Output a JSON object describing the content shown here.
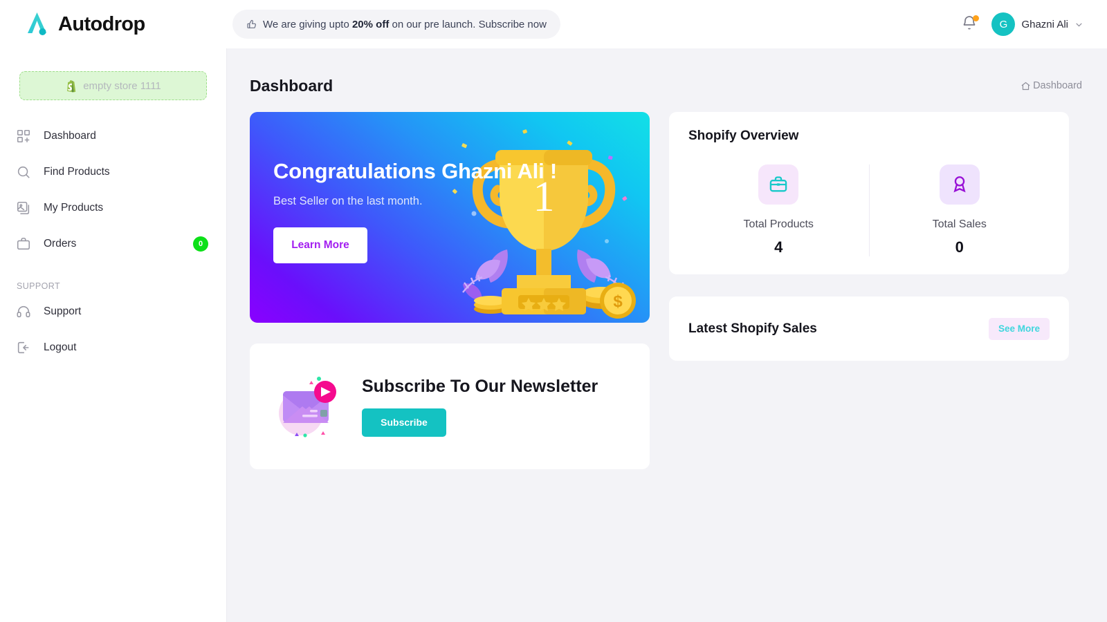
{
  "brand": {
    "name": "Autodrop",
    "logo_icon": "autodrop-a-logo"
  },
  "announcement": {
    "icon": "thumbs-up-icon",
    "prefix": "We are giving upto ",
    "highlight": "20% off",
    "suffix": " on our pre launch. Subscribe now"
  },
  "topbar": {
    "notifications_icon": "bell-icon",
    "avatar_initial": "G",
    "user_name": "Ghazni Ali",
    "chevron_icon": "chevron-down-icon"
  },
  "sidebar": {
    "store": {
      "icon": "shopify-bag-icon",
      "label": "empty store 1111"
    },
    "items": [
      {
        "icon": "grid-plus-icon",
        "label": "Dashboard"
      },
      {
        "icon": "search-icon",
        "label": "Find Products"
      },
      {
        "icon": "image-stack-icon",
        "label": "My Products"
      },
      {
        "icon": "briefcase-icon",
        "label": "Orders",
        "badge": "0"
      }
    ],
    "section_label": "SUPPORT",
    "support_items": [
      {
        "icon": "headphones-icon",
        "label": "Support"
      },
      {
        "icon": "logout-icon",
        "label": "Logout"
      }
    ]
  },
  "page": {
    "title": "Dashboard",
    "breadcrumb": {
      "icon": "home-icon",
      "label": "Dashboard"
    }
  },
  "congrats": {
    "heading": "Congratulations Ghazni Ali !",
    "subtext": "Best Seller on the last month.",
    "button": "Learn More",
    "art": "trophy-illustration",
    "trophy_rank": "1"
  },
  "newsletter": {
    "art": "envelope-illustration",
    "heading": "Subscribe To Our Newsletter",
    "button": "Subscribe"
  },
  "overview": {
    "title": "Shopify Overview",
    "stats": [
      {
        "icon": "briefcase-icon",
        "label": "Total Products",
        "value": "4"
      },
      {
        "icon": "award-ribbon-icon",
        "label": "Total Sales",
        "value": "0"
      }
    ]
  },
  "latest_sales": {
    "title": "Latest Shopify Sales",
    "button": "See More"
  },
  "colors": {
    "brand_teal": "#15c2c2",
    "badge_green": "#0ce018",
    "accent_purple": "#a31ef0",
    "page_bg": "#f3f3f7",
    "banner_from": "#8a00ff",
    "banner_to": "#12e0e6"
  }
}
